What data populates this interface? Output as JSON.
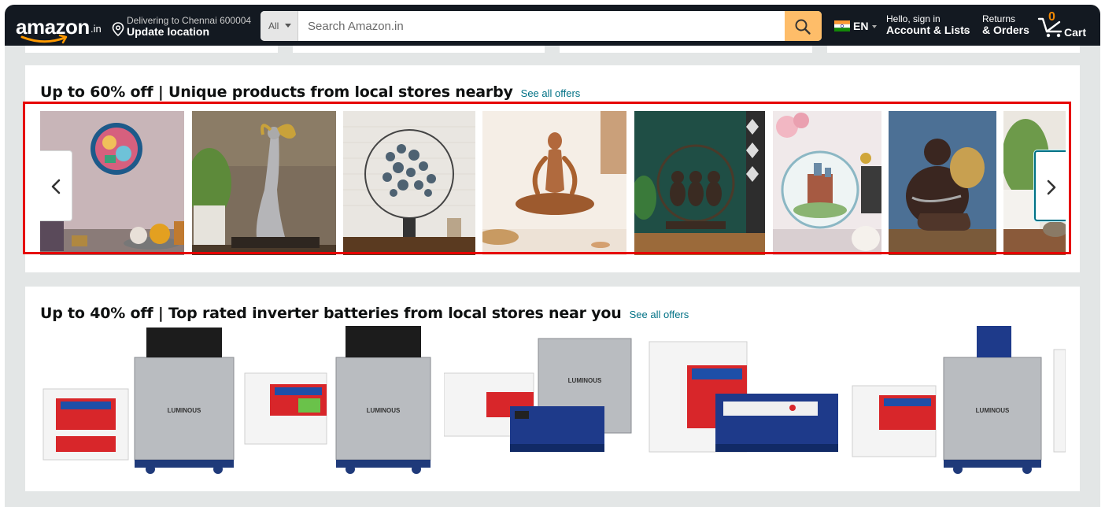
{
  "header": {
    "logo_text": "amazon",
    "logo_tld": ".in",
    "delivery_line1": "Delivering to Chennai 600004",
    "delivery_line2": "Update location",
    "search_category": "All",
    "search_placeholder": "Search Amazon.in",
    "language": "EN",
    "account_line1": "Hello, sign in",
    "account_line2": "Account & Lists",
    "orders_line1": "Returns",
    "orders_line2": "& Orders",
    "cart_count": "0",
    "cart_label": "Cart"
  },
  "sections": [
    {
      "title": "Up to 60% off | Unique products from local stores nearby",
      "link": "See all offers",
      "items": [
        "decorative-plate-teacups",
        "silver-dancer-statue",
        "butterfly-ring-sculpture",
        "yoga-figurine",
        "three-monkeys-ring",
        "castle-decorative-plate",
        "laughing-buddha-statue",
        "green-plant-pot"
      ]
    },
    {
      "title": "Up to 40% off | Top rated inverter batteries from local stores near you",
      "link": "See all offers",
      "brand_text": "LUMINOUS",
      "items": [
        "luminous-battery-trolley-combo",
        "luminous-battery-trolley-combo-2",
        "luminous-battery-inverter-combo",
        "luminous-tall-battery-inverter",
        "luminous-battery-trolley-combo-3"
      ]
    }
  ],
  "colors": {
    "nav_bg": "#131921",
    "search_button": "#febd69",
    "link": "#007185",
    "highlight": "#e60000",
    "cart_count": "#f08804"
  }
}
